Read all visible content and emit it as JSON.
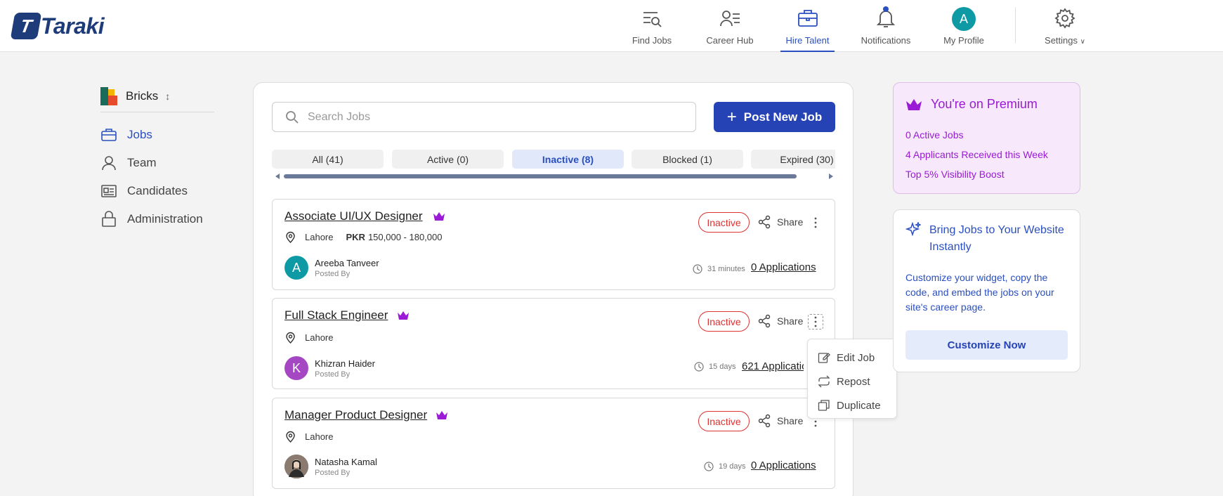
{
  "app": {
    "logo_letter": "T",
    "logo_text": "Taraki"
  },
  "nav": {
    "items": [
      {
        "label": "Find Jobs"
      },
      {
        "label": "Career Hub"
      },
      {
        "label": "Hire Talent"
      },
      {
        "label": "Notifications"
      },
      {
        "label": "My Profile",
        "avatar_letter": "A"
      },
      {
        "label": "Settings"
      }
    ],
    "active": "Hire Talent"
  },
  "sidebar": {
    "org_name": "Bricks",
    "org_sort_icon": "sort-icon",
    "items": [
      {
        "label": "Jobs"
      },
      {
        "label": "Team"
      },
      {
        "label": "Candidates"
      },
      {
        "label": "Administration"
      }
    ]
  },
  "main": {
    "search_placeholder": "Search Jobs",
    "post_button": "Post New Job",
    "tabs": [
      {
        "label": "All (41)"
      },
      {
        "label": "Active (0)"
      },
      {
        "label": "Inactive (8)"
      },
      {
        "label": "Blocked (1)"
      },
      {
        "label": "Expired (30)"
      }
    ],
    "jobs": [
      {
        "title": "Associate UI/UX Designer",
        "location": "Lahore",
        "salary_currency": "PKR",
        "salary_range": "150,000 -  180,000",
        "poster_name": "Areeba Tanveer",
        "poster_sub": "Posted By",
        "avatar_letter": "A",
        "status": "Inactive",
        "share": "Share",
        "time": "31 minutes",
        "applications": "0 Applications"
      },
      {
        "title": "Full Stack Engineer",
        "location": "Lahore",
        "poster_name": "Khizran Haider",
        "poster_sub": "Posted By",
        "avatar_letter": "K",
        "status": "Inactive",
        "share": "Share",
        "time": "15 days",
        "applications": "621 Applications"
      },
      {
        "title": "Manager Product Designer",
        "location": "Lahore",
        "poster_name": "Natasha Kamal",
        "poster_sub": "Posted By",
        "status": "Inactive",
        "share": "Share",
        "time": "19 days",
        "applications": "0 Applications"
      }
    ]
  },
  "dropdown": {
    "items": [
      {
        "label": "Edit Job"
      },
      {
        "label": "Repost"
      },
      {
        "label": "Duplicate"
      }
    ]
  },
  "premium": {
    "title": "You're on Premium",
    "lines": [
      "0 Active Jobs",
      "4 Applicants Received this Week",
      "Top 5% Visibility Boost"
    ]
  },
  "widget": {
    "title": "Bring Jobs to Your Website Instantly",
    "description": "Customize your widget, copy the code, and embed the jobs on your site's career page.",
    "button": "Customize Now"
  },
  "colors": {
    "primary": "#2543b5",
    "accent_link": "#2a4fc0",
    "premium": "#9a1ad6",
    "inactive": "#dd3333",
    "avatar_teal": "#0e9aa5",
    "avatar_purple": "#a546c2"
  }
}
